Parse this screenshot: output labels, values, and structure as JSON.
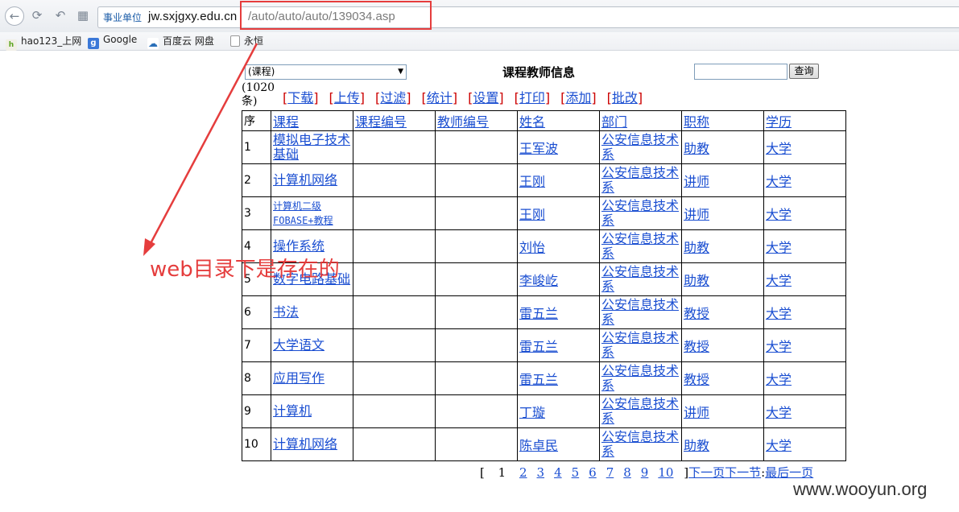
{
  "browser": {
    "url_tag": "事业单位",
    "url_host": "jw.sxjgxy.edu.cn",
    "url_path": "/auto/auto/auto/139034.asp",
    "bookmarks": [
      "hao123_上网",
      "Google",
      "百度云 网盘",
      "永恒"
    ]
  },
  "page": {
    "select_value": "(课程)",
    "title": "课程教师信息",
    "search_button": "查询",
    "count_text": "(1020条)",
    "actions": [
      "下载",
      "上传",
      "过滤",
      "统计",
      "设置",
      "打印",
      "添加",
      "批改"
    ]
  },
  "table": {
    "headers": [
      "序",
      "课程",
      "课程编号",
      "教师编号",
      "姓名",
      "部门",
      "职称",
      "学历"
    ],
    "rows": [
      {
        "no": "1",
        "course": "模拟电子技术基础",
        "name": "王军波",
        "dept": "公安信息技术系",
        "title": "助教",
        "edu": "大学"
      },
      {
        "no": "2",
        "course": "计算机网络",
        "name": "王刚",
        "dept": "公安信息技术系",
        "title": "讲师",
        "edu": "大学"
      },
      {
        "no": "3",
        "course": "计算机二级FOBASE+教程",
        "name": "王刚",
        "dept": "公安信息技术系",
        "title": "讲师",
        "edu": "大学"
      },
      {
        "no": "4",
        "course": "操作系统",
        "name": "刘怡",
        "dept": "公安信息技术系",
        "title": "助教",
        "edu": "大学"
      },
      {
        "no": "5",
        "course": "数字电路基础",
        "name": "李峻屹",
        "dept": "公安信息技术系",
        "title": "助教",
        "edu": "大学"
      },
      {
        "no": "6",
        "course": "书法",
        "name": "雷五兰",
        "dept": "公安信息技术系",
        "title": "教授",
        "edu": "大学"
      },
      {
        "no": "7",
        "course": "大学语文",
        "name": "雷五兰",
        "dept": "公安信息技术系",
        "title": "教授",
        "edu": "大学"
      },
      {
        "no": "8",
        "course": "应用写作",
        "name": "雷五兰",
        "dept": "公安信息技术系",
        "title": "教授",
        "edu": "大学"
      },
      {
        "no": "9",
        "course": "计算机",
        "name": "丁璇",
        "dept": "公安信息技术系",
        "title": "讲师",
        "edu": "大学"
      },
      {
        "no": "10",
        "course": "计算机网络",
        "name": "陈卓民",
        "dept": "公安信息技术系",
        "title": "助教",
        "edu": "大学"
      }
    ]
  },
  "pager": {
    "open": "[",
    "current": "1",
    "pages": [
      "2",
      "3",
      "4",
      "5",
      "6",
      "7",
      "8",
      "9",
      "10"
    ],
    "close": "]",
    "next": "下一页",
    "next_section": "下一节",
    "last": "最后一页"
  },
  "annotation": {
    "text": "web目录下是存在的",
    "color": "#e53d3d"
  },
  "watermark": "www.wooyun.org"
}
